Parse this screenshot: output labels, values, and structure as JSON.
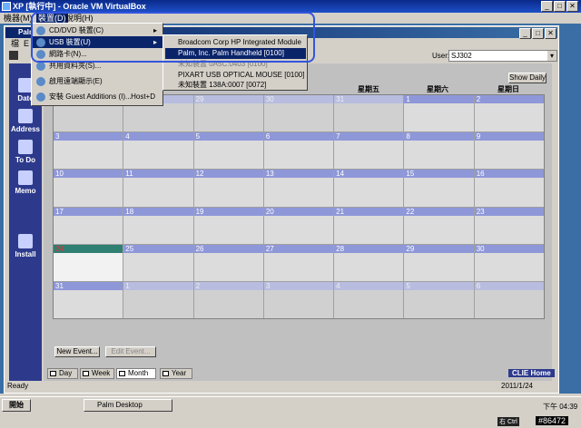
{
  "vbox": {
    "title": "XP [執行中] - Oracle VM VirtualBox",
    "menu": [
      "機器(M)",
      "裝置(D)",
      "說明(H)"
    ]
  },
  "devices_menu": {
    "items": [
      {
        "label": "CD/DVD 裝置(C)",
        "arrow": "▸"
      },
      {
        "label": "USB 裝置(U)",
        "arrow": "▸"
      },
      {
        "label": "網路卡(N)..."
      },
      {
        "label": "共用資料夾(S)..."
      },
      {
        "label": "啟用遠端顯示(E)"
      },
      {
        "label": "安裝 Guest Additions (I)...",
        "shortcut": "Host+D"
      }
    ]
  },
  "usb_menu": {
    "items": [
      "Broadcom Corp HP Integrated Module [0306]",
      "Palm, Inc. Palm Handheld [0100]",
      "未知裝置 0A5C:0403 [0100]",
      "PIXART USB OPTICAL MOUSE [0100]",
      "未知裝置 138A:0007 [0072]"
    ]
  },
  "palm": {
    "title": "Palm",
    "menu": [
      "檔",
      "E"
    ],
    "user_label": "User:",
    "user_value": "SJ302",
    "show_daily": "Show Daily",
    "sidebar": [
      "Date",
      "Address",
      "To Do",
      "Memo",
      "Install"
    ],
    "day_headers": [
      "星期五",
      "星期六",
      "星期日"
    ],
    "new_event": "New Event...",
    "edit_event": "Edit Event...",
    "tabs": [
      "Day",
      "Week",
      "Month",
      "Year"
    ],
    "brand": "CLIE Home",
    "status": "Ready",
    "status_date": "2011/1/24"
  },
  "calendar": {
    "weeks": [
      [
        "27",
        "28",
        "29",
        "30",
        "31",
        "1",
        "2"
      ],
      [
        "3",
        "4",
        "5",
        "6",
        "7",
        "8",
        "9"
      ],
      [
        "10",
        "11",
        "12",
        "13",
        "14",
        "15",
        "16"
      ],
      [
        "17",
        "18",
        "19",
        "20",
        "21",
        "22",
        "23"
      ],
      [
        "24",
        "25",
        "26",
        "27",
        "28",
        "29",
        "30"
      ],
      [
        "31",
        "1",
        "2",
        "3",
        "4",
        "5",
        "6"
      ]
    ]
  },
  "taskbar": {
    "start": "開始",
    "task": "Palm Desktop",
    "clock": "下午 04:39",
    "tray_host": "右 Ctrl",
    "tag": "#86472"
  }
}
